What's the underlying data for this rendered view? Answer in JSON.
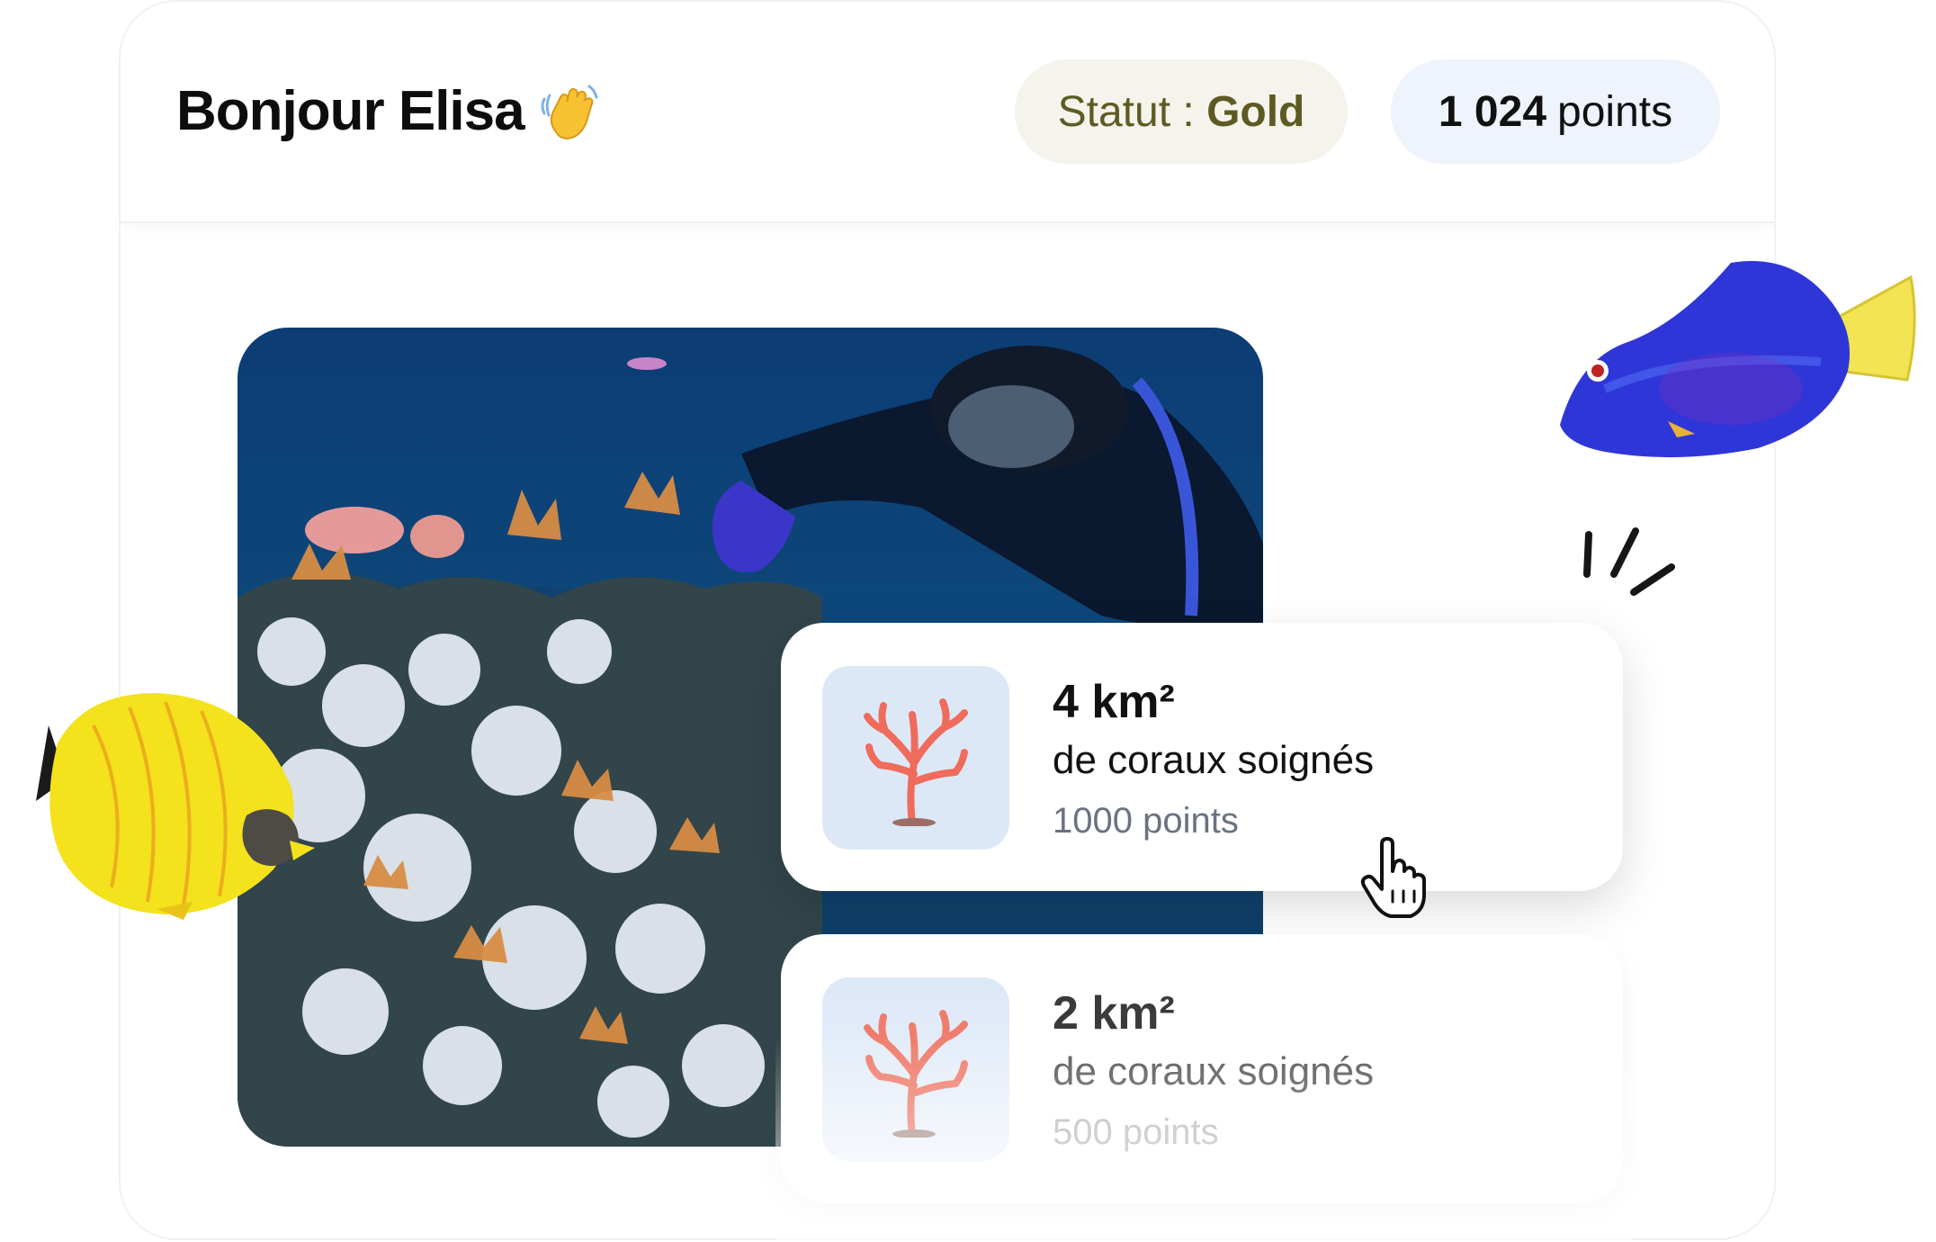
{
  "header": {
    "greeting": "Bonjour Elisa",
    "status_label": "Statut :",
    "status_value": "Gold",
    "points_value": "1 024",
    "points_unit": "points"
  },
  "rewards": [
    {
      "area": "4 km²",
      "description": "de coraux soignés",
      "points": "1000 points"
    },
    {
      "area": "2 km²",
      "description": "de coraux soignés",
      "points": "500 points"
    }
  ],
  "colors": {
    "status_pill_bg": "#f4f4ec",
    "status_text": "#5e5a23",
    "points_pill_bg": "#eff3fc",
    "thumb_bg": "#dde8f7",
    "coral": "#ef6b5b"
  },
  "icons": {
    "greeting": "waving-hand-icon",
    "reward": "coral-icon",
    "pointer": "hand-cursor-icon"
  }
}
